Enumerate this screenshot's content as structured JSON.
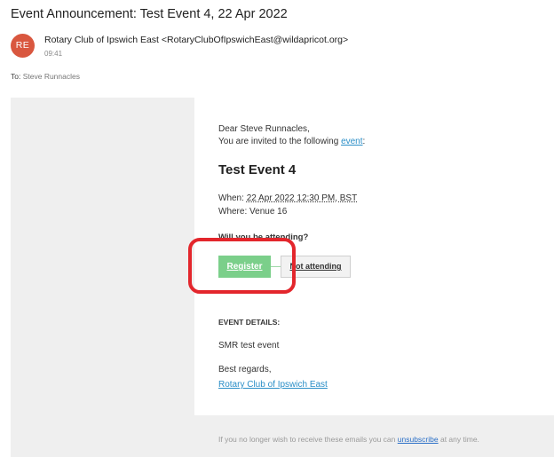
{
  "email": {
    "subject": "Event Announcement: Test Event 4, 22 Apr 2022",
    "avatar_initials": "RE",
    "sender": "Rotary Club of Ipswich East <RotaryClubOfIpswichEast@wildapricot.org>",
    "time": "09:41",
    "to_label": "To:",
    "to_value": "Steve Runnacles"
  },
  "body": {
    "greeting": "Dear Steve Runnacles,",
    "invite_prefix": "You are invited to the following",
    "invite_link": "event",
    "invite_suffix": ":",
    "event_title": "Test Event 4",
    "when_label": "When:",
    "when_value": "22 Apr 2022 12:30 PM, BST",
    "where_label": "Where:",
    "where_value": "Venue 16",
    "attending_question": "Will you be attending?",
    "register_label": "Register",
    "not_attending_label": "Not attending",
    "details_heading": "EVENT DETAILS:",
    "details_text": "SMR test event",
    "regards": "Best regards,",
    "club_link": "Rotary Club of Ipswich East"
  },
  "footer": {
    "prefix": "If you no longer wish to receive these emails you can",
    "unsubscribe_link": "unsubscribe",
    "suffix": "at any time."
  },
  "colors": {
    "avatar": "#d9573f",
    "register_button": "#7bcf8a",
    "link": "#2a8ec7",
    "highlight": "#e3262c"
  }
}
